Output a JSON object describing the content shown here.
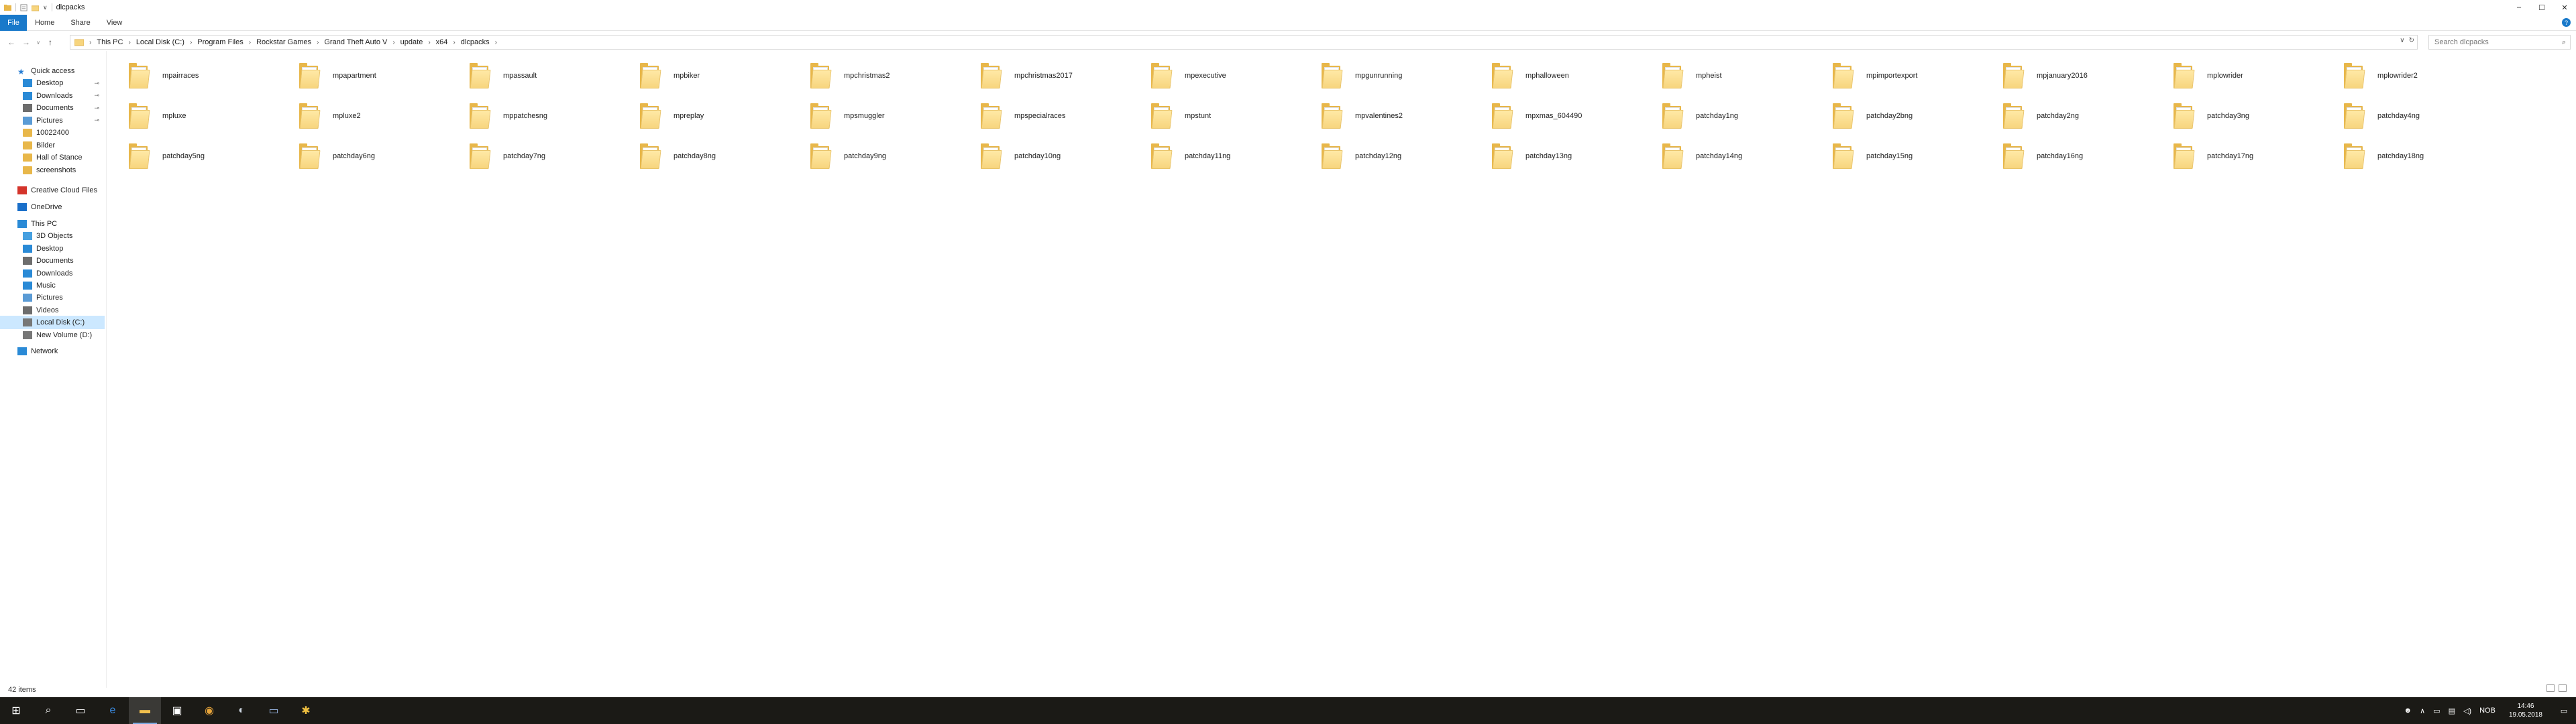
{
  "window": {
    "title": "dlcpacks",
    "controls": {
      "minimize": "–",
      "maximize": "☐",
      "close": "✕"
    }
  },
  "ribbon": {
    "tabs": [
      "File",
      "Home",
      "Share",
      "View"
    ],
    "help": "?"
  },
  "address": {
    "breadcrumbs": [
      "This PC",
      "Local Disk (C:)",
      "Program Files",
      "Rockstar Games",
      "Grand Theft Auto V",
      "update",
      "x64",
      "dlcpacks"
    ],
    "search_placeholder": "Search dlcpacks"
  },
  "nav": {
    "items": [
      {
        "label": "Quick access",
        "icon": "star-icon",
        "level": 0,
        "pinned": false,
        "selected": false
      },
      {
        "label": "Desktop",
        "icon": "desktop-icon",
        "level": 1,
        "pinned": true,
        "selected": false
      },
      {
        "label": "Downloads",
        "icon": "download-icon",
        "level": 1,
        "pinned": true,
        "selected": false
      },
      {
        "label": "Documents",
        "icon": "documents-icon",
        "level": 1,
        "pinned": true,
        "selected": false
      },
      {
        "label": "Pictures",
        "icon": "pictures-icon",
        "level": 1,
        "pinned": true,
        "selected": false
      },
      {
        "label": "10022400",
        "icon": "folder-icon",
        "level": 1,
        "pinned": false,
        "selected": false
      },
      {
        "label": "Bilder",
        "icon": "folder-icon",
        "level": 1,
        "pinned": false,
        "selected": false
      },
      {
        "label": "Hall of Stance",
        "icon": "folder-icon",
        "level": 1,
        "pinned": false,
        "selected": false
      },
      {
        "label": "screenshots",
        "icon": "folder-icon",
        "level": 1,
        "pinned": false,
        "selected": false
      },
      {
        "label": "Creative Cloud Files",
        "icon": "creative-cloud-icon",
        "level": 0,
        "pinned": false,
        "selected": false
      },
      {
        "label": "OneDrive",
        "icon": "onedrive-icon",
        "level": 0,
        "pinned": false,
        "selected": false
      },
      {
        "label": "This PC",
        "icon": "computer-icon",
        "level": 0,
        "pinned": false,
        "selected": false
      },
      {
        "label": "3D Objects",
        "icon": "3d-objects-icon",
        "level": 1,
        "pinned": false,
        "selected": false
      },
      {
        "label": "Desktop",
        "icon": "desktop-icon",
        "level": 1,
        "pinned": false,
        "selected": false
      },
      {
        "label": "Documents",
        "icon": "documents-icon",
        "level": 1,
        "pinned": false,
        "selected": false
      },
      {
        "label": "Downloads",
        "icon": "download-icon",
        "level": 1,
        "pinned": false,
        "selected": false
      },
      {
        "label": "Music",
        "icon": "music-icon",
        "level": 1,
        "pinned": false,
        "selected": false
      },
      {
        "label": "Pictures",
        "icon": "pictures-icon",
        "level": 1,
        "pinned": false,
        "selected": false
      },
      {
        "label": "Videos",
        "icon": "videos-icon",
        "level": 1,
        "pinned": false,
        "selected": false
      },
      {
        "label": "Local Disk (C:)",
        "icon": "drive-icon",
        "level": 1,
        "pinned": false,
        "selected": true
      },
      {
        "label": "New Volume (D:)",
        "icon": "drive-icon",
        "level": 1,
        "pinned": false,
        "selected": false
      },
      {
        "label": "Network",
        "icon": "network-icon",
        "level": 0,
        "pinned": false,
        "selected": false
      }
    ]
  },
  "files": [
    "mpairraces",
    "mpapartment",
    "mpassault",
    "mpbiker",
    "mpchristmas2",
    "mpchristmas2017",
    "mpexecutive",
    "mpgunrunning",
    "mphalloween",
    "mpheist",
    "mpimportexport",
    "mpjanuary2016",
    "mplowrider",
    "mplowrider2",
    "mpluxe",
    "mpluxe2",
    "mppatchesng",
    "mpreplay",
    "mpsmuggler",
    "mpspecialraces",
    "mpstunt",
    "mpvalentines2",
    "mpxmas_604490",
    "patchday1ng",
    "patchday2bng",
    "patchday2ng",
    "patchday3ng",
    "patchday4ng",
    "patchday5ng",
    "patchday6ng",
    "patchday7ng",
    "patchday8ng",
    "patchday9ng",
    "patchday10ng",
    "patchday11ng",
    "patchday12ng",
    "patchday13ng",
    "patchday14ng",
    "patchday15ng",
    "patchday16ng",
    "patchday17ng",
    "patchday18ng"
  ],
  "status": {
    "item_count": "42 items"
  },
  "taskbar": {
    "apps": [
      "start-icon",
      "search-icon",
      "task-view-icon",
      "edge-icon",
      "file-explorer-icon",
      "store-icon",
      "chrome-icon",
      "steam-icon",
      "app-window-icon",
      "rockstar-launcher-icon"
    ],
    "tray": {
      "language": "NOB",
      "time": "14:46",
      "date": "19.05.2018"
    }
  },
  "colors": {
    "accent": "#1979ca",
    "selection": "#cce8ff",
    "folder": "#f7d57e",
    "taskbar": "#1b1a16"
  }
}
